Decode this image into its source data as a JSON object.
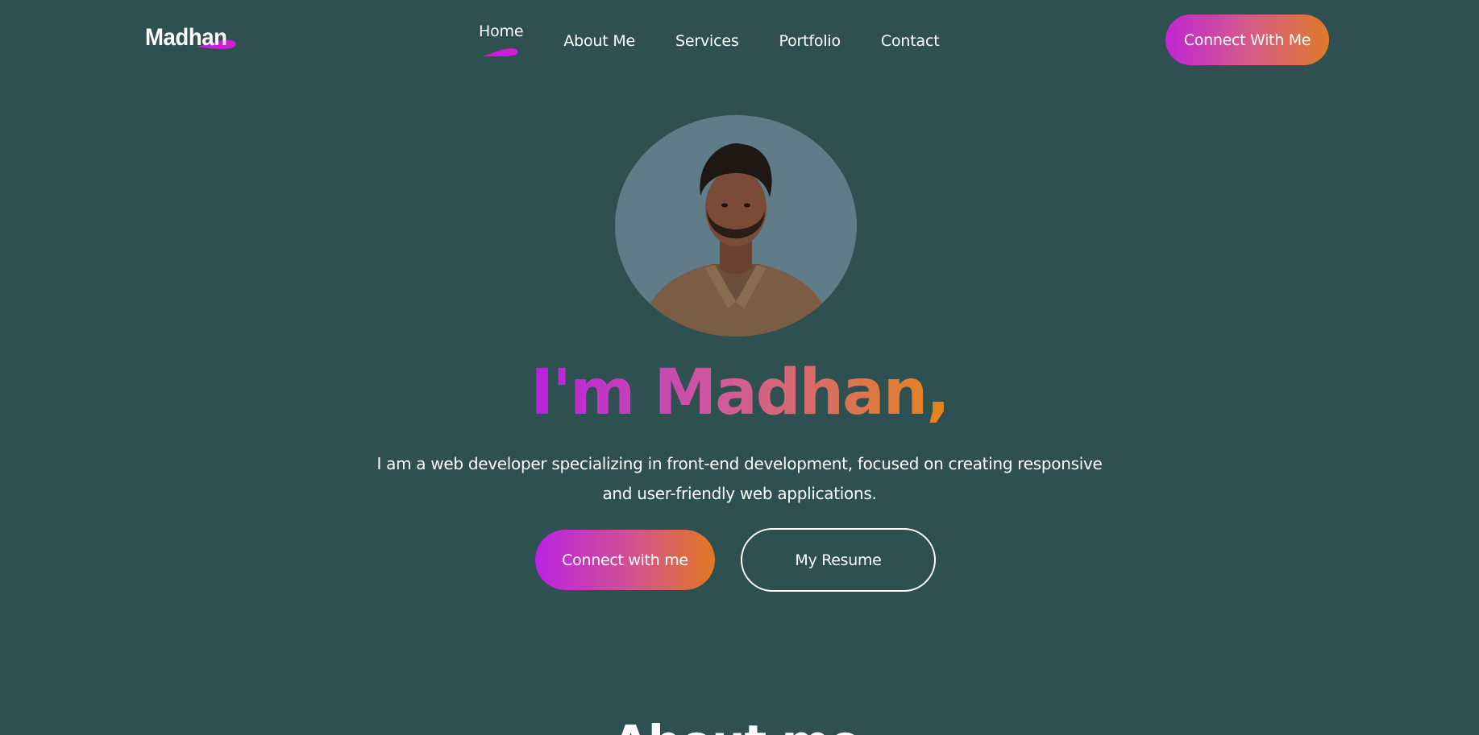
{
  "brand": {
    "logo_text": "Madhan",
    "accent_color": "#d21bd6"
  },
  "nav": {
    "items": [
      {
        "label": "Home",
        "active": true
      },
      {
        "label": "About Me",
        "active": false
      },
      {
        "label": "Services",
        "active": false
      },
      {
        "label": "Portfolio",
        "active": false
      },
      {
        "label": "Contact",
        "active": false
      }
    ],
    "cta_label": "Connect With Me"
  },
  "hero": {
    "title": "I'm Madhan,",
    "description_line1": "I am a web developer specializing in front-end development, focused on creating responsive",
    "description_line2": "and user-friendly web applications.",
    "primary_button": "Connect with me",
    "secondary_button": "My Resume",
    "avatar_icon": "profile-photo"
  },
  "next_section": {
    "heading": "About me"
  },
  "colors": {
    "background": "#2f5050",
    "avatar_bg": "#5f7c88",
    "gradient_start": "#bb22e2",
    "gradient_mid": "#d2538f",
    "gradient_end": "#e0791f"
  }
}
